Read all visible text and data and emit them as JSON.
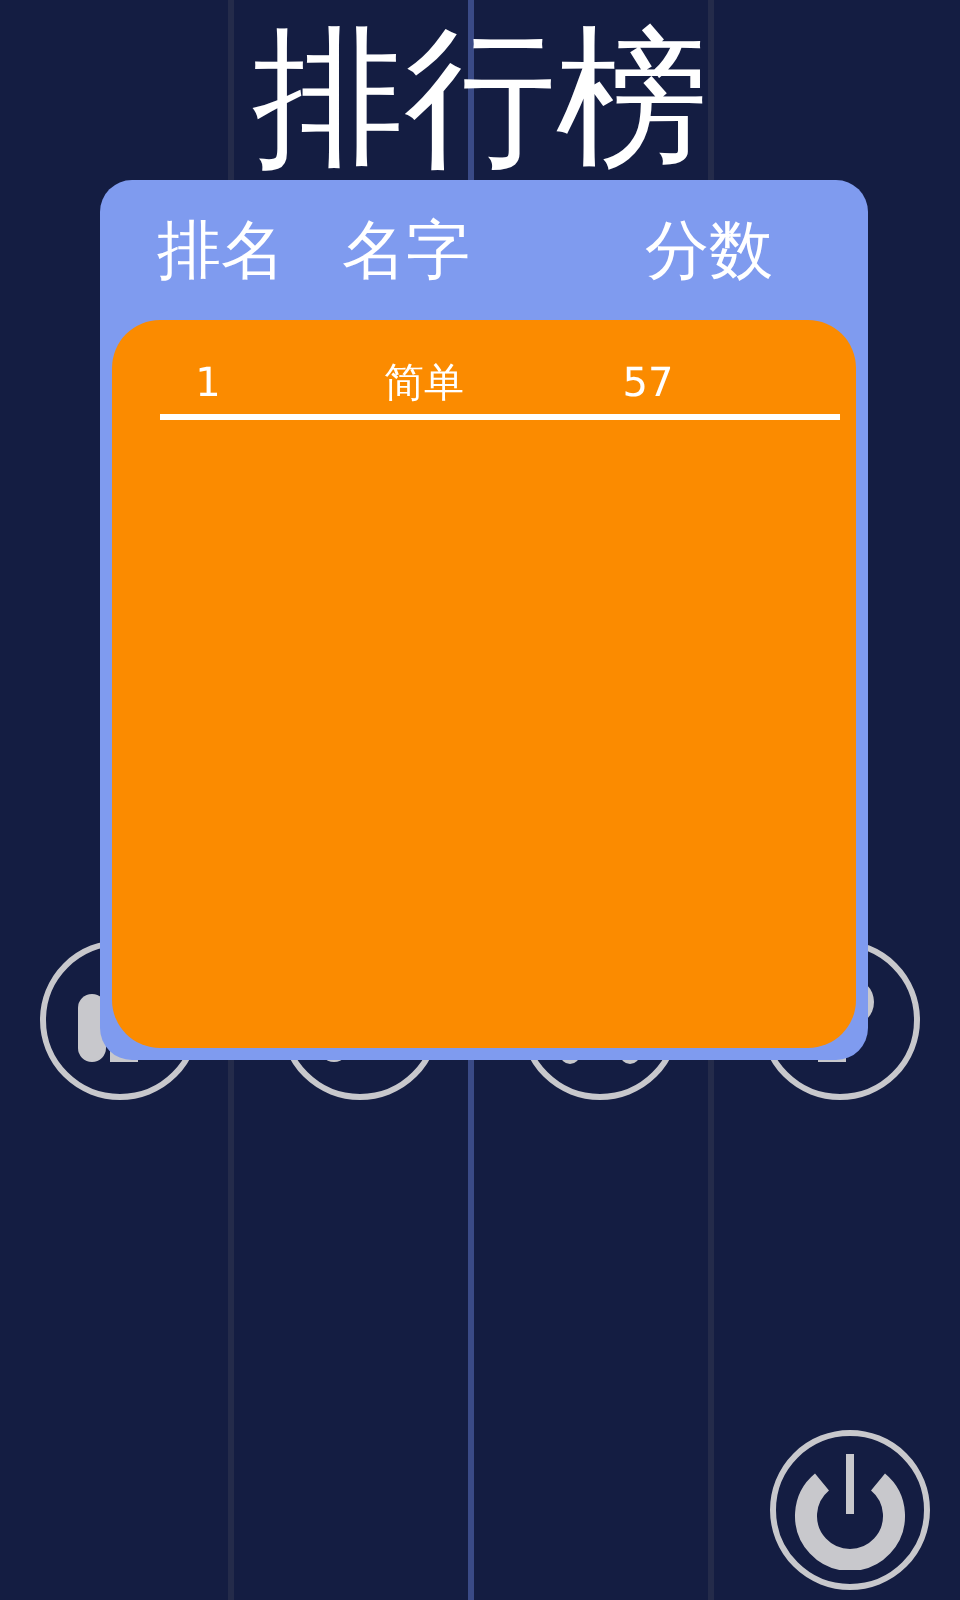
{
  "title": "排行榜",
  "leaderboard": {
    "columns": [
      "排名",
      "名字",
      "分数"
    ],
    "rows": [
      {
        "rank": "1",
        "name": "简单",
        "score": "57"
      }
    ]
  }
}
